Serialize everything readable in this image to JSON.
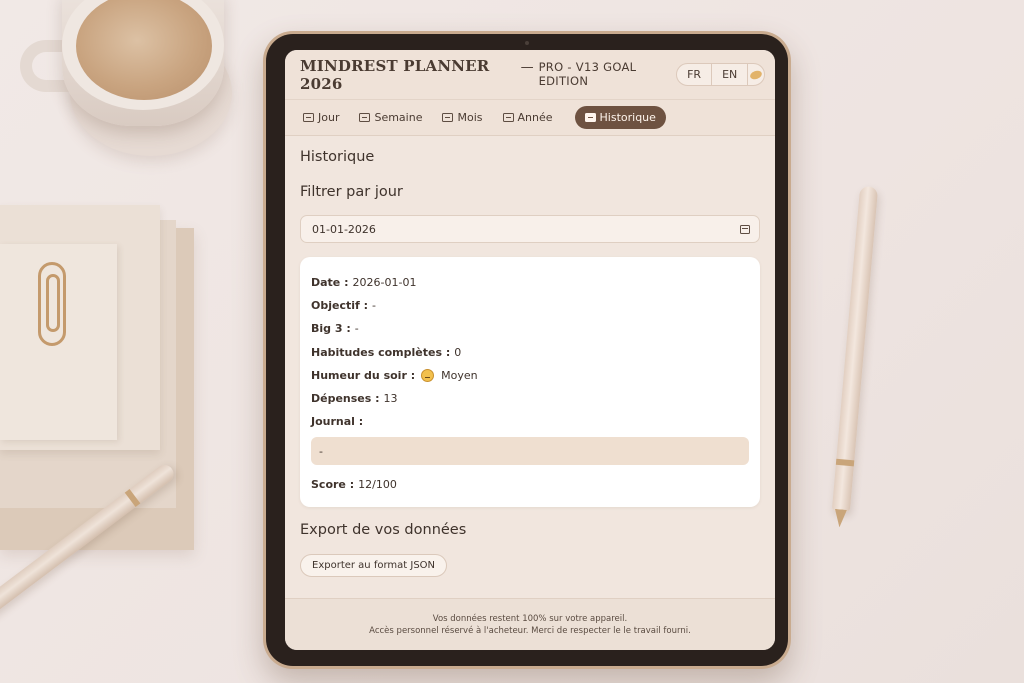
{
  "header": {
    "brand": "MINDREST PLANNER 2026",
    "dash": "—",
    "edition": "PRO - V13 GOAL EDITION",
    "lang_fr": "FR",
    "lang_en": "EN",
    "theme_icon": "moon-icon"
  },
  "tabs": [
    {
      "label": "Jour",
      "icon": "calendar-icon"
    },
    {
      "label": "Semaine",
      "icon": "calendar-icon"
    },
    {
      "label": "Mois",
      "icon": "calendar-icon"
    },
    {
      "label": "Année",
      "icon": "calendar-icon"
    },
    {
      "label": "Historique",
      "icon": "document-icon",
      "active": true
    }
  ],
  "main": {
    "page_title": "Historique",
    "filter_title": "Filtrer par jour",
    "date_value": "01-01-2026",
    "record": {
      "date_label": "Date :",
      "date_value": "2026-01-01",
      "objectif_label": "Objectif :",
      "objectif_value": "-",
      "big3_label": "Big 3 :",
      "big3_value": "-",
      "habitudes_label": "Habitudes complètes :",
      "habitudes_value": "0",
      "humeur_label": "Humeur du soir :",
      "humeur_value": "Moyen",
      "depenses_label": "Dépenses :",
      "depenses_value": "13",
      "journal_label": "Journal :",
      "journal_value": "-",
      "score_label": "Score :",
      "score_value": "12/100"
    },
    "export_title": "Export de vos données",
    "export_button": "Exporter au format JSON"
  },
  "footer": {
    "line1": "Vos données restent 100% sur votre appareil.",
    "line2": "Accès personnel réservé à l'acheteur.  Merci de respecter le le travail fourni."
  },
  "colors": {
    "accent": "#6e5241",
    "background": "#f1e6de",
    "card": "#ffffff",
    "journal_box": "#efdfd0"
  }
}
